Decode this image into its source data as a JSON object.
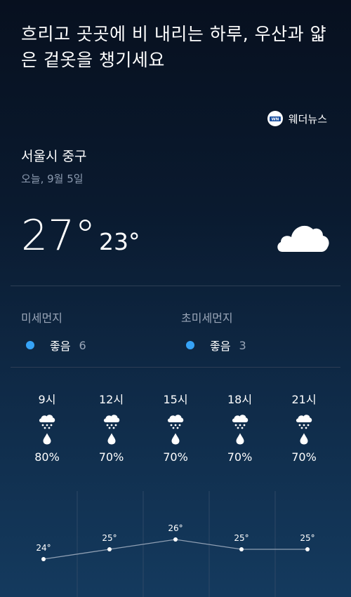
{
  "headline": "흐리고 곳곳에 비 내리는 하루, 우산과 얇은 겉옷을 챙기세요",
  "source": {
    "name": "웨더뉴스",
    "logo_icon": "weathernews-logo-icon"
  },
  "location": "서울시 중구",
  "date": "오늘,   9월 5일",
  "current": {
    "high": "27°",
    "low": "23°",
    "icon": "cloud-icon"
  },
  "air_quality": [
    {
      "label": "미세먼지",
      "grade": "좋음",
      "value": "6",
      "color": "#36a3f7"
    },
    {
      "label": "초미세먼지",
      "grade": "좋음",
      "value": "3",
      "color": "#36a3f7"
    }
  ],
  "hourly": [
    {
      "time": "9시",
      "icon": "cloud-rain-icon",
      "precip": "80%"
    },
    {
      "time": "12시",
      "icon": "cloud-rain-icon",
      "precip": "70%"
    },
    {
      "time": "15시",
      "icon": "cloud-rain-icon",
      "precip": "70%"
    },
    {
      "time": "18시",
      "icon": "cloud-rain-icon",
      "precip": "70%"
    },
    {
      "time": "21시",
      "icon": "cloud-rain-icon",
      "precip": "70%"
    }
  ],
  "chart_data": {
    "type": "line",
    "x": [
      "9시",
      "12시",
      "15시",
      "18시",
      "21시"
    ],
    "values": [
      24,
      25,
      26,
      25,
      25
    ],
    "labels": [
      "24°",
      "25°",
      "26°",
      "25°",
      "25°"
    ],
    "ylim": [
      22,
      28
    ]
  }
}
